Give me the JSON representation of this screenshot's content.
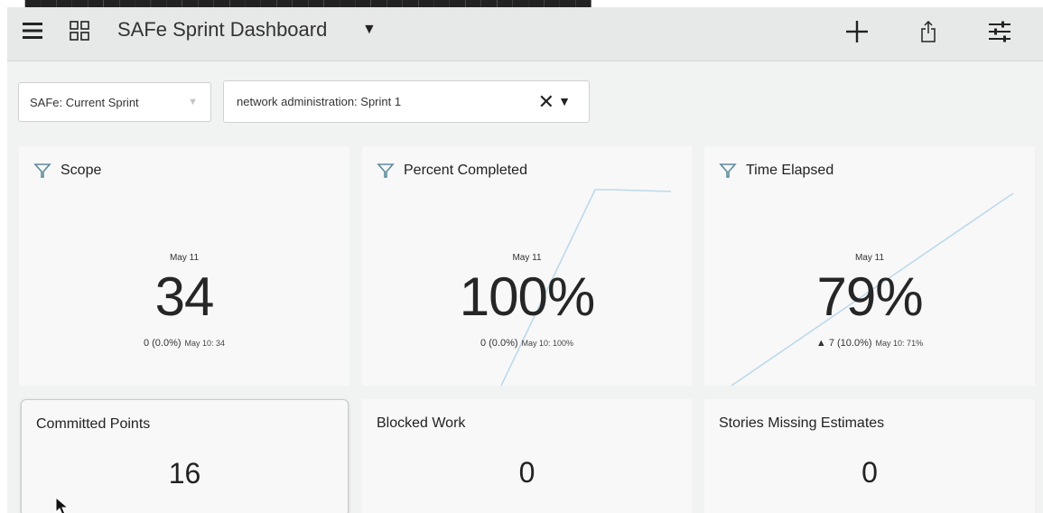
{
  "header": {
    "title": "SAFe Sprint Dashboard",
    "title_caret": "▼",
    "icons": [
      "hamburger-menu-icon",
      "grid-layout-icon",
      "plus-icon",
      "share-icon",
      "sliders-icon"
    ]
  },
  "filters": {
    "program": {
      "value": "SAFe: Current Sprint",
      "caret": "▼"
    },
    "sprint": {
      "value": "network administration: Sprint 1",
      "clear": "✕",
      "caret": "▼"
    }
  },
  "metrics": [
    {
      "title": "Scope",
      "date": "May 11",
      "value": "34",
      "change": "0 (0.0%)",
      "previous": "May 10: 34"
    },
    {
      "title": "Percent Completed",
      "date": "May 11",
      "value": "100%",
      "change": "0 (0.0%)",
      "previous": "May 10: 100%"
    },
    {
      "title": "Time Elapsed",
      "date": "May 11",
      "value": "79%",
      "change": "▲ 7 (10.0%)",
      "previous": "May 10: 71%"
    }
  ],
  "counters": [
    {
      "title": "Committed Points",
      "value": "16"
    },
    {
      "title": "Blocked Work",
      "value": "0"
    },
    {
      "title": "Stories Missing Estimates",
      "value": "0"
    }
  ],
  "colors": {
    "funnel_icon": "#5b8a9a",
    "trend_line": "#bcd9ec",
    "header_bg": "#e7e8e8",
    "card_bg": "#f8f8f8"
  }
}
